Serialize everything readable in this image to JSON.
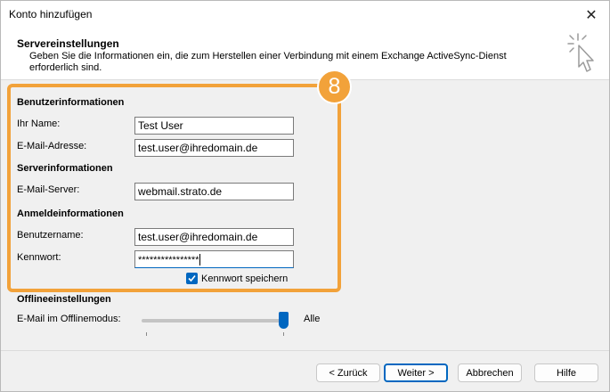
{
  "window": {
    "title": "Konto hinzufügen",
    "close_glyph": "✕"
  },
  "header": {
    "title": "Servereinstellungen",
    "description": "Geben Sie die Informationen ein, die zum Herstellen einer Verbindung mit einem Exchange ActiveSync-Dienst erforderlich sind."
  },
  "badge": {
    "number": "8",
    "color": "#f2a23a"
  },
  "user_info": {
    "title": "Benutzerinformationen",
    "name_label": "Ihr Name:",
    "name_value": "Test User",
    "email_label": "E-Mail-Adresse:",
    "email_value": "test.user@ihredomain.de"
  },
  "server_info": {
    "title": "Serverinformationen",
    "server_label": "E-Mail-Server:",
    "server_value": "webmail.strato.de"
  },
  "login_info": {
    "title": "Anmeldeinformationen",
    "username_label": "Benutzername:",
    "username_value": "test.user@ihredomain.de",
    "password_label": "Kennwort:",
    "password_value": "****************",
    "remember_label": "Kennwort speichern",
    "remember_checked": true
  },
  "offline": {
    "title": "Offlineeinstellungen",
    "mode_label": "E-Mail im Offlinemodus:",
    "mode_value": "Alle"
  },
  "buttons": {
    "back": "< Zurück",
    "next": "Weiter >",
    "cancel": "Abbrechen",
    "help": "Hilfe"
  },
  "colors": {
    "accent": "#0067c0",
    "highlight": "#f2a23a"
  }
}
